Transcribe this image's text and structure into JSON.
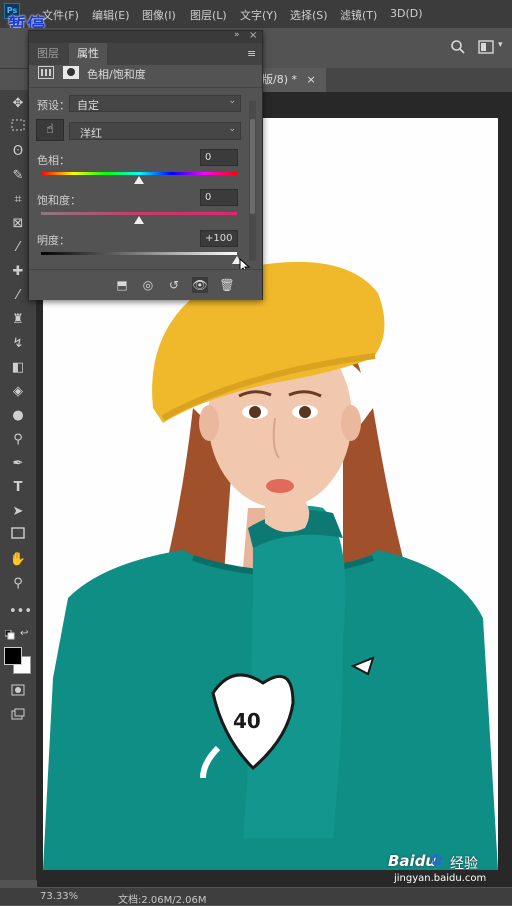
{
  "overlay": {
    "pause_label": "暂停"
  },
  "app": {
    "logo_text": "Ps"
  },
  "menubar": {
    "items": [
      "文件(F)",
      "编辑(E)",
      "图像(I)",
      "图层(L)",
      "文字(Y)",
      "选择(S)",
      "滤镜(T)",
      "3D(D)"
    ]
  },
  "document_tab": {
    "title": "版/8) *",
    "close": "×"
  },
  "properties_panel": {
    "tabs": [
      "图层",
      "属性"
    ],
    "active_tab": "属性",
    "adjustment_title": "色相/饱和度",
    "preset_label": "预设：",
    "preset_value": "自定",
    "channel_value": "洋红",
    "hue": {
      "label": "色相：",
      "value": "0",
      "level": 0
    },
    "saturation": {
      "label": "饱和度：",
      "value": "0",
      "level": 0
    },
    "lightness": {
      "label": "明度：",
      "value": "+100",
      "level": 100
    }
  },
  "statusbar": {
    "zoom": "73.33%",
    "doc_info": "文档:2.06M/2.06M"
  },
  "watermark": {
    "brand": "Baidu",
    "product": "经验",
    "url": "jingyan.baidu.com"
  },
  "colors": {
    "accent": "#1c3bd8",
    "sweater": "#0f8e86",
    "beret": "#f0b92c",
    "panel_bg": "#535353"
  }
}
